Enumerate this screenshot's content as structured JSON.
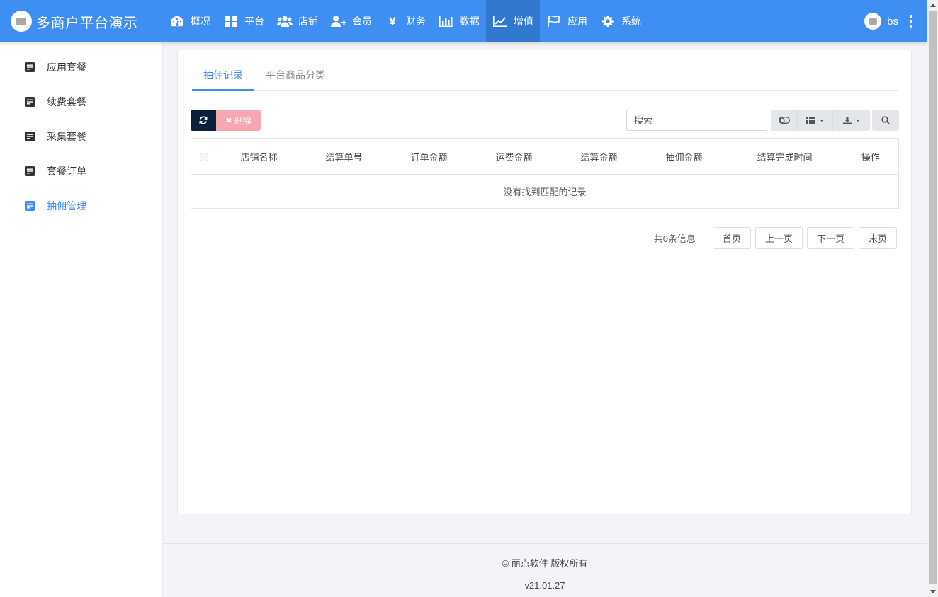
{
  "app": {
    "title": "多商户平台演示"
  },
  "colors": {
    "primary": "#3f8ef2",
    "active_nav": "#3278cf",
    "dark_button": "#0b1f3a",
    "danger_light": "#f6a7b3"
  },
  "topnav": [
    {
      "label": "概况",
      "icon": "dashboard-icon"
    },
    {
      "label": "平台",
      "icon": "grid-icon"
    },
    {
      "label": "店铺",
      "icon": "users-icon"
    },
    {
      "label": "会员",
      "icon": "user-plus-icon"
    },
    {
      "label": "财务",
      "icon": "yen-icon"
    },
    {
      "label": "数据",
      "icon": "bar-chart-icon"
    },
    {
      "label": "增值",
      "icon": "line-chart-icon",
      "active": true
    },
    {
      "label": "应用",
      "icon": "flag-icon"
    },
    {
      "label": "系统",
      "icon": "gear-icon"
    }
  ],
  "user": {
    "name": "bs"
  },
  "sidebar": {
    "items": [
      {
        "label": "应用套餐"
      },
      {
        "label": "续费套餐"
      },
      {
        "label": "采集套餐"
      },
      {
        "label": "套餐订单"
      },
      {
        "label": "抽佣管理",
        "active": true
      }
    ]
  },
  "tabs": [
    {
      "label": "抽佣记录",
      "active": true
    },
    {
      "label": "平台商品分类"
    }
  ],
  "toolbar": {
    "delete_label": "删除",
    "search_placeholder": "搜索"
  },
  "table": {
    "columns": [
      "店铺名称",
      "结算单号",
      "订单金额",
      "运费金额",
      "结算金额",
      "抽佣金额",
      "结算完成时间",
      "操作"
    ],
    "empty_text": "没有找到匹配的记录"
  },
  "pagination": {
    "info": "共0条信息",
    "first": "首页",
    "prev": "上一页",
    "next": "下一页",
    "last": "末页"
  },
  "footer": {
    "copyright": "© 丽点软件 版权所有",
    "version": "v21.01.27"
  }
}
